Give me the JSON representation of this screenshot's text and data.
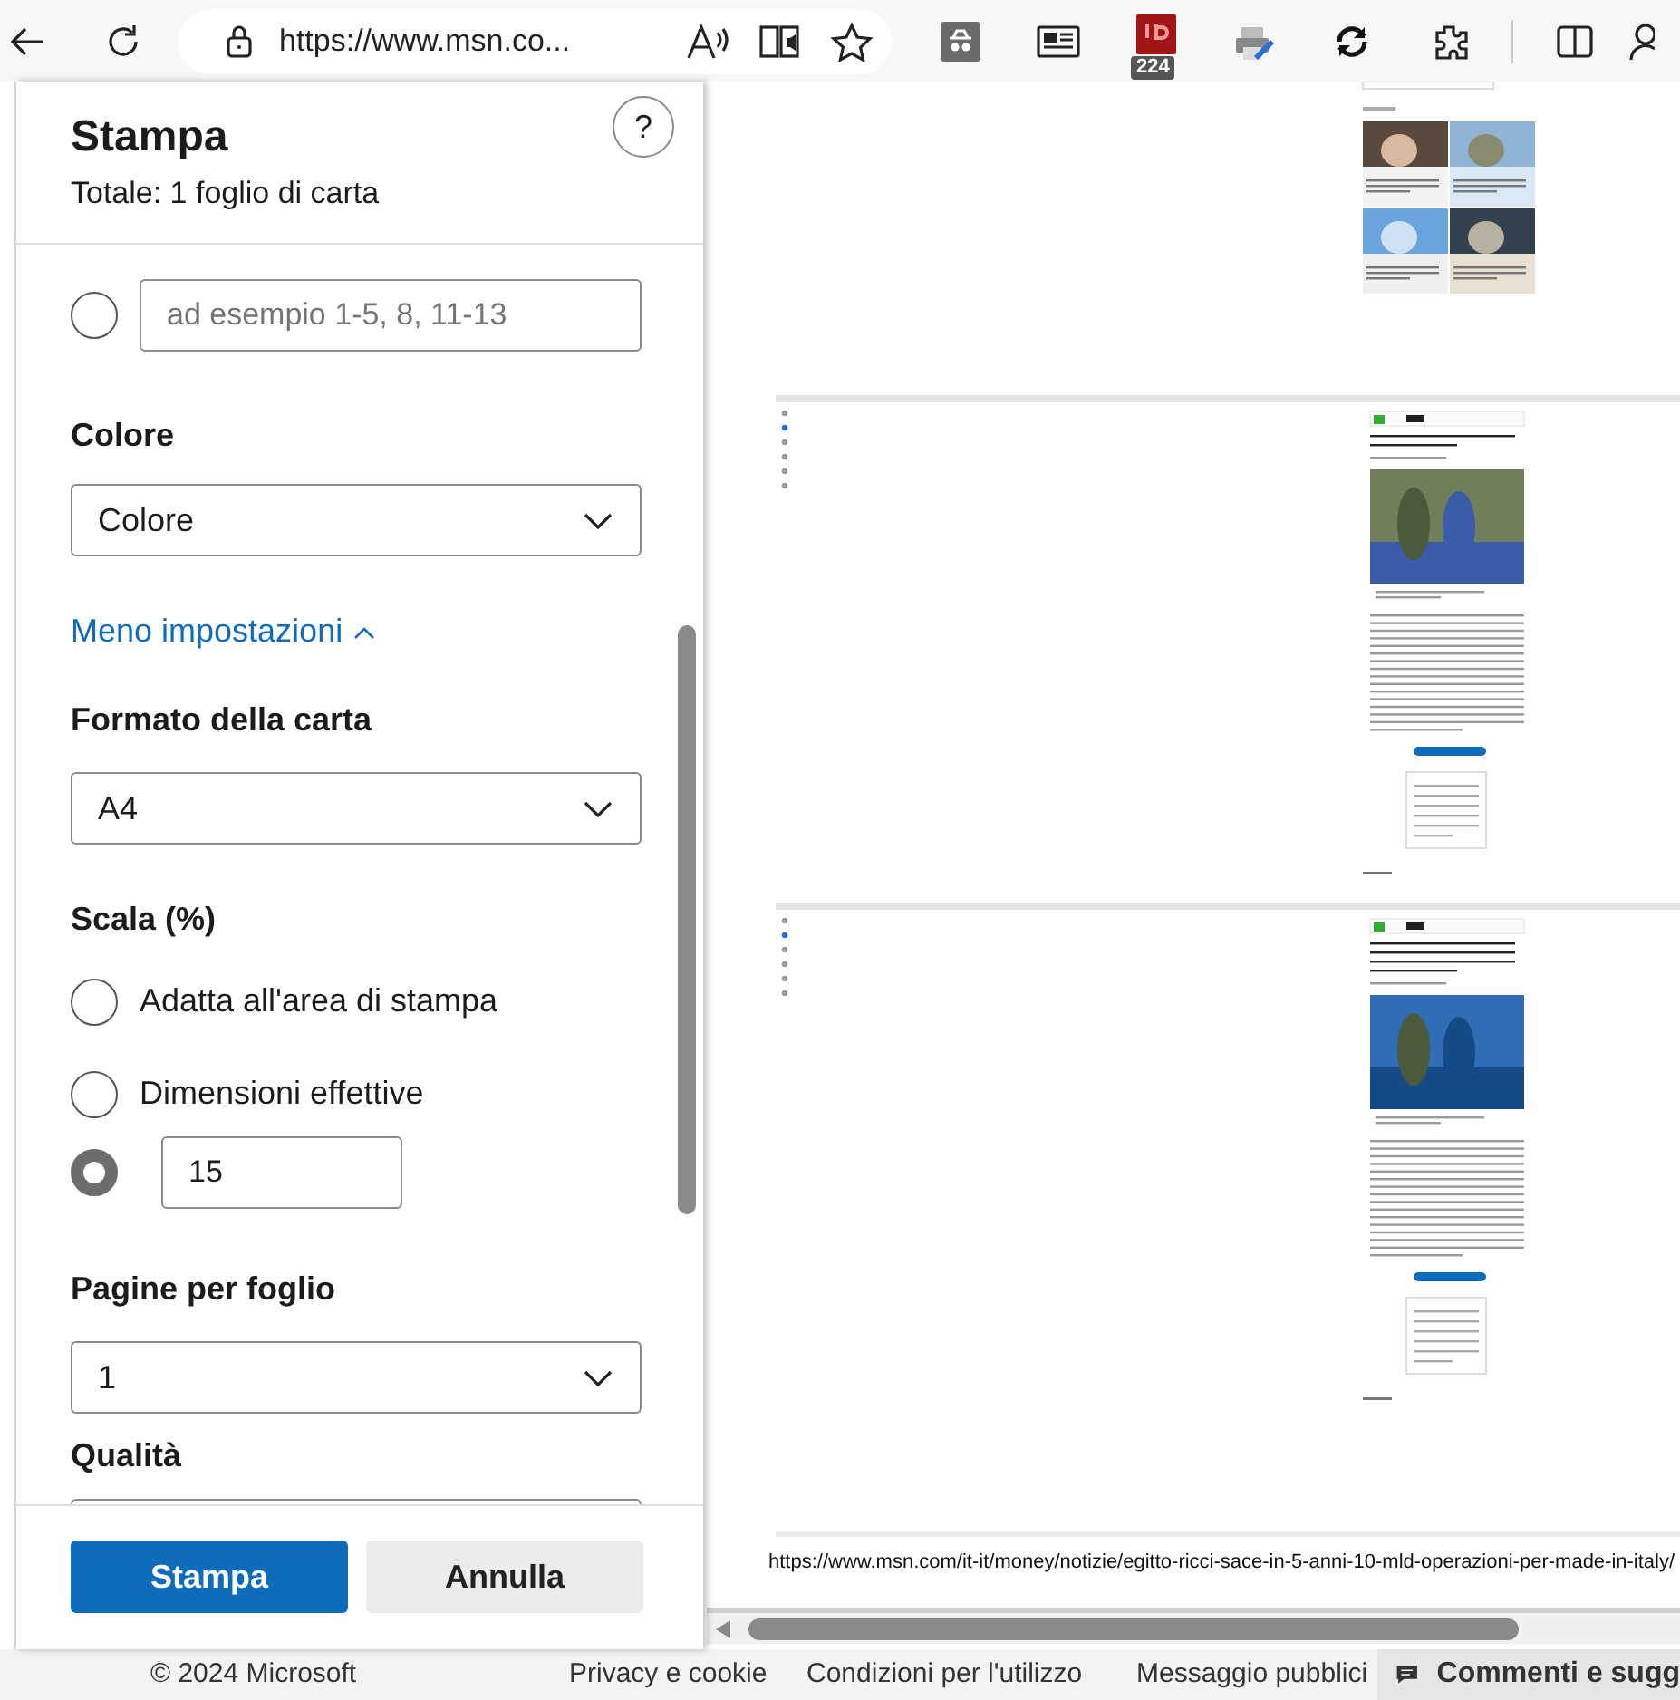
{
  "toolbar": {
    "address": "https://www.msn.co...",
    "badge": "224"
  },
  "print_dialog": {
    "title": "Stampa",
    "subtitle": "Totale: 1 foglio di carta",
    "help": "?",
    "pages_option": {
      "selected": false,
      "placeholder": "ad esempio 1-5, 8, 11-13"
    },
    "color": {
      "label": "Colore",
      "value": "Colore"
    },
    "settings_link": {
      "label": "Meno impostazioni",
      "expanded": true
    },
    "paper_size": {
      "label": "Formato della carta",
      "value": "A4"
    },
    "scale": {
      "label": "Scala (%)",
      "options": [
        {
          "kind": "radio",
          "label": "Adatta all'area di stampa",
          "selected": false
        },
        {
          "kind": "radio",
          "label": "Dimensioni effettive",
          "selected": false
        },
        {
          "kind": "input",
          "value": "15",
          "selected": true
        }
      ]
    },
    "pages_per_sheet": {
      "label": "Pagine per foglio",
      "value": "1"
    },
    "quality": {
      "label": "Qualità"
    },
    "buttons": [
      {
        "kind": "primary",
        "label": "Stampa"
      },
      {
        "kind": "secondary",
        "label": "Annulla"
      }
    ]
  },
  "preview": {
    "footer_url": "https://www.msn.com/it-it/money/notizie/egitto-ricci-sace-in-5-anni-10-mld-operazioni-per-made-in-italy/"
  },
  "page_footer": {
    "copyright": "© 2024 Microsoft",
    "links": [
      "Privacy e cookie",
      "Condizioni per l'utilizzo",
      "Messaggio pubblici"
    ],
    "feedback": "Commenti e sugg"
  }
}
